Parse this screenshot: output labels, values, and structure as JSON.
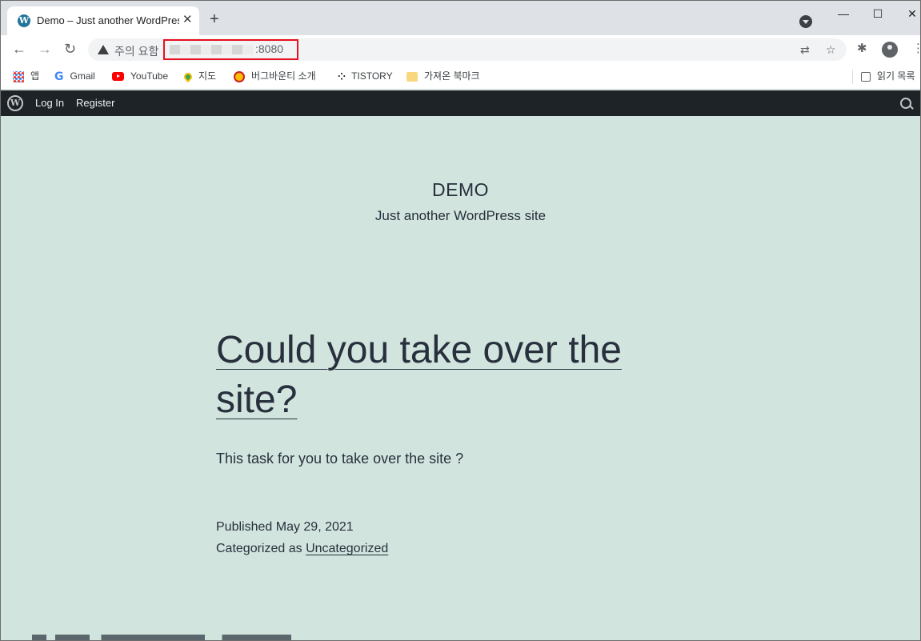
{
  "browser": {
    "tab": {
      "title": "Demo – Just another WordPress site",
      "favicon": "wordpress-icon"
    },
    "new_tab_label": "+",
    "window_controls": {
      "minimize": "—",
      "maximize": "☐",
      "close": "✕"
    },
    "address_bar": {
      "security_label": "주의 요함",
      "url_port": ":8080",
      "icons": [
        "back-icon",
        "forward-icon",
        "reload-icon",
        "warning-icon",
        "translate-icon",
        "star-icon",
        "extensions-icon",
        "profile-icon",
        "menu-icon"
      ]
    },
    "bookmarks": [
      {
        "label": "앱",
        "icon": "apps-icon"
      },
      {
        "label": "Gmail",
        "icon": "google-icon"
      },
      {
        "label": "YouTube",
        "icon": "youtube-icon"
      },
      {
        "label": "지도",
        "icon": "maps-icon"
      },
      {
        "label": "버그바운티 소개",
        "icon": "bug-icon"
      },
      {
        "label": "TISTORY",
        "icon": "tistory-icon"
      },
      {
        "label": "가져온 북마크",
        "icon": "folder-icon"
      }
    ],
    "reading_list_label": "읽기 목록"
  },
  "admin_bar": {
    "login_label": "Log In",
    "register_label": "Register"
  },
  "site": {
    "title": "DEMO",
    "tagline": "Just another WordPress site",
    "post": {
      "title": "Could you take over the site?",
      "excerpt": "This task for you to take over the site ?",
      "published_prefix": "Published",
      "published_date": "May 29, 2021",
      "category_prefix": "Categorized as",
      "category": "Uncategorized"
    }
  },
  "colors": {
    "site_background": "#d1e4dd",
    "text": "#28303d",
    "admin_bar": "#1d2327",
    "url_highlight": "#e8111f"
  }
}
